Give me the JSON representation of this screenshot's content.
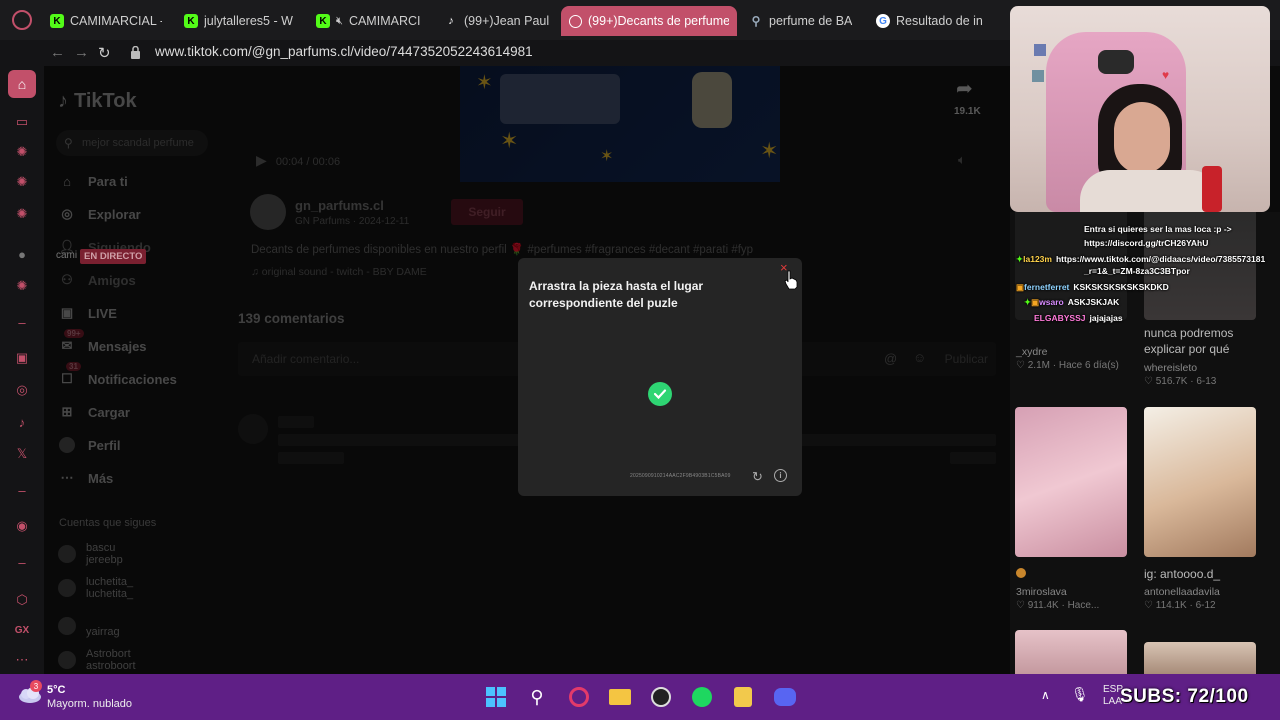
{
  "browser": {
    "tabs": [
      {
        "label": "CAMIMARCIAL -",
        "icon": "kick-icon",
        "active": false
      },
      {
        "label": "julytalleres5 - W",
        "icon": "kick-icon",
        "active": false
      },
      {
        "label": "CAMIMARCI",
        "icon": "kick-icon",
        "active": false
      },
      {
        "label": "(99+)Jean Paul",
        "icon": "tiktok-icon",
        "active": false
      },
      {
        "label": "(99+)Decants de perfume",
        "icon": "globe-icon",
        "active": true
      },
      {
        "label": "perfume de BA",
        "icon": "search-icon",
        "active": false
      },
      {
        "label": "Resultado de in",
        "icon": "google-icon",
        "active": false
      }
    ],
    "url": "www.tiktok.com/@gn_parfums.cl/video/7447352052243614981"
  },
  "tiktok": {
    "logo": "TikTok",
    "search_placeholder": "mejor scandal perfume",
    "nav": [
      {
        "label": "Para ti",
        "icon": "home-icon"
      },
      {
        "label": "Explorar",
        "icon": "compass-icon"
      },
      {
        "label": "Siguiendo",
        "icon": "user-icon"
      },
      {
        "label": "Amigos",
        "icon": "friends-icon"
      },
      {
        "label": "LIVE",
        "icon": "live-icon"
      },
      {
        "label": "Mensajes",
        "icon": "message-icon",
        "badge": "99+"
      },
      {
        "label": "Notificaciones",
        "icon": "notification-icon",
        "badge": "31"
      },
      {
        "label": "Cargar",
        "icon": "upload-icon"
      },
      {
        "label": "Perfil",
        "icon": "profile-icon"
      },
      {
        "label": "Más",
        "icon": "more-icon"
      }
    ],
    "following_title": "Cuentas que sigues",
    "following": [
      {
        "name": "bascu",
        "handle": "jereebp"
      },
      {
        "name": "luchetita_",
        "handle": "luchetita_"
      },
      {
        "name": "",
        "handle": "yairrag"
      },
      {
        "name": "Astrobort",
        "handle": "astroboort"
      }
    ],
    "live_badge": "EN DIRECTO",
    "live_name": "cami",
    "video": {
      "time": "00:04 / 00:06",
      "share_count": "19.1K"
    },
    "author": {
      "username": "gn_parfums.cl",
      "subtitle": "GN Parfums · 2024-12-11",
      "follow_label": "Seguir"
    },
    "caption": "Decants de perfumes disponibles en nuestro perfil 🌹 #perfumes #fragrances #decant #parati #fyp",
    "sound": "original sound - twitch - BBY DAME",
    "comments_count": "139 comentarios",
    "comment_placeholder": "Añadir comentario...",
    "comment_post": "Publicar"
  },
  "captcha": {
    "title": "Arrastra la pieza hasta el lugar correspondiente del puzle",
    "close": "×",
    "code": "2025090910214AAC2F9B4903B1C5BA09"
  },
  "right_cards": [
    {
      "user": "_xydre",
      "title": "",
      "meta": "♡ 2.1M · Hace 6 día(s)"
    },
    {
      "user": "whereisleto",
      "title": "nunca podremos explicar por qué",
      "meta": "♡ 516.7K · 6-13"
    },
    {
      "user": "3miroslava",
      "title": "",
      "meta": "♡ 911.4K · Hace..."
    },
    {
      "user": "antonellaadavila",
      "title": "ig: antoooo.d_",
      "meta": "♡ 114.1K · 6-12"
    }
  ],
  "chat": [
    {
      "user": "",
      "text": "Entra si quieres ser la mas loca :p ->",
      "color": "#f5d142"
    },
    {
      "user": "",
      "text": "https://discord.gg/trCH26YAhU",
      "color": "#ffffff"
    },
    {
      "user": "la123m",
      "text": "https://www.tiktok.com/@didaacs/video/7385573181",
      "color": "#ffd24a"
    },
    {
      "user": "",
      "text": "_r=1&_t=ZM-8za3C3BTpor",
      "color": "#ffffff"
    },
    {
      "user": "fernetferret",
      "text": "KSKSKSKSKSKSKDKD",
      "color": "#8fd3ff"
    },
    {
      "user": "wsaro",
      "text": "ASKJSKJAK",
      "color": "#d88cff"
    },
    {
      "user": "ELGABYSSJ",
      "text": "jajajajas",
      "color": "#ff7ad9"
    }
  ],
  "taskbar": {
    "weather_badge": "3",
    "temperature": "5°C",
    "weather": "Mayorm. nublado",
    "lang_top": "ESP",
    "lang_bottom": "LAA",
    "subs": "SUBS: 72/100"
  }
}
